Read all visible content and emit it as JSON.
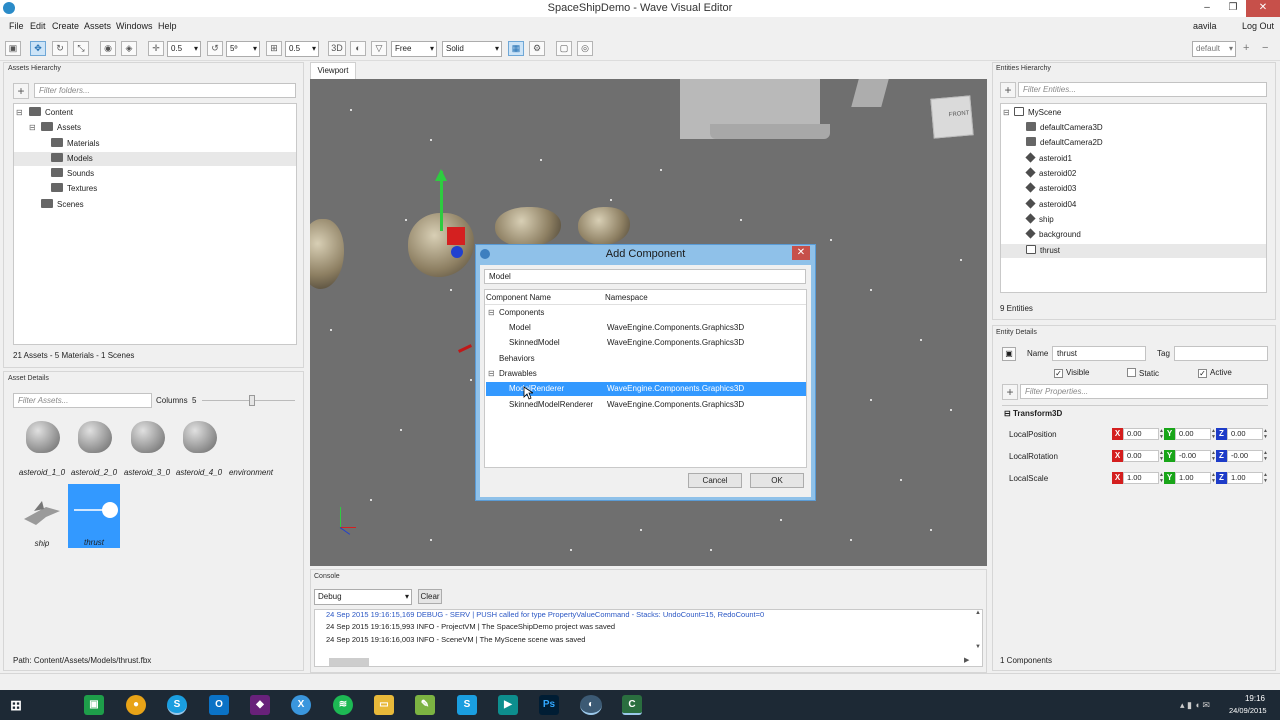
{
  "window": {
    "title": "SpaceShipDemo - Wave Visual Editor"
  },
  "menu": [
    "File",
    "Edit",
    "Create",
    "Assets",
    "Windows",
    "Help"
  ],
  "user": {
    "name": "aavila",
    "logout": "Log Out",
    "layout": "default"
  },
  "toolbar": {
    "snap1": "0.5",
    "snap2": "5º",
    "snap3": "0.5",
    "mode3d": "3D",
    "camera": "Free",
    "shading": "Solid"
  },
  "assets_hierarchy": {
    "title": "Assets Hierarchy",
    "filter_placeholder": "Filter folders...",
    "tree": [
      "Content",
      "Assets",
      "Materials",
      "Models",
      "Sounds",
      "Textures",
      "Scenes"
    ],
    "summary": "21 Assets - 5 Materials - 1 Scenes"
  },
  "asset_details": {
    "title": "Asset Details",
    "filter_placeholder": "Filter Assets...",
    "columns_label": "Columns",
    "columns_value": "5",
    "items": [
      "asteroid_1_0",
      "asteroid_2_0",
      "asteroid_3_0",
      "asteroid_4_0",
      "environment",
      "ship",
      "thrust"
    ],
    "path": "Path: Content/Assets/Models/thrust.fbx"
  },
  "viewport": {
    "tab": "Viewport",
    "cube_label": "FRONT"
  },
  "dialog": {
    "title": "Add Component",
    "search_value": "Model",
    "col_name": "Component Name",
    "col_namespace": "Namespace",
    "groups": {
      "components": "Components",
      "behaviors": "Behaviors",
      "drawables": "Drawables"
    },
    "rows": [
      {
        "name": "Model",
        "ns": "WaveEngine.Components.Graphics3D"
      },
      {
        "name": "SkinnedModel",
        "ns": "WaveEngine.Components.Graphics3D"
      },
      {
        "name": "ModelRenderer",
        "ns": "WaveEngine.Components.Graphics3D"
      },
      {
        "name": "SkinnedModelRenderer",
        "ns": "WaveEngine.Components.Graphics3D"
      }
    ],
    "cancel": "Cancel",
    "ok": "OK"
  },
  "console": {
    "title": "Console",
    "level": "Debug",
    "clear": "Clear",
    "lines": [
      "24 Sep 2015 19:16:15,169 DEBUG - SERV   | PUSH called for type PropertyValueCommand - Stacks: UndoCount=15, RedoCount=0",
      "24 Sep 2015 19:16:15,993 INFO - ProjectVM | The SpaceShipDemo project was saved",
      "24 Sep 2015 19:16:16,003 INFO - SceneVM | The MyScene scene was saved"
    ]
  },
  "entities": {
    "title": "Entities Hierarchy",
    "filter_placeholder": "Filter Entities...",
    "root": "MyScene",
    "items": [
      "defaultCamera3D",
      "defaultCamera2D",
      "asteroid1",
      "asteroid02",
      "asteroid03",
      "asteroid04",
      "ship",
      "background",
      "thrust"
    ],
    "count": "9 Entities"
  },
  "entity_details": {
    "title": "Entity Details",
    "name_label": "Name",
    "name_value": "thrust",
    "tag_label": "Tag",
    "visible": "Visible",
    "static": "Static",
    "active": "Active",
    "filter_placeholder": "Filter Properties...",
    "component": "Transform3D",
    "props": [
      {
        "label": "LocalPosition",
        "x": "0.00",
        "y": "0.00",
        "z": "0.00"
      },
      {
        "label": "LocalRotation",
        "x": "0.00",
        "y": "-0.00",
        "z": "-0.00"
      },
      {
        "label": "LocalScale",
        "x": "1.00",
        "y": "1.00",
        "z": "1.00"
      }
    ],
    "count": "1 Components"
  },
  "clock": {
    "time": "19:16",
    "date": "24/09/2015"
  },
  "colors": {
    "accent": "#3399ff",
    "selection": "#3399ff",
    "axis_x": "#d41e1e",
    "axis_y": "#19a519",
    "axis_z": "#1e3cc8"
  }
}
